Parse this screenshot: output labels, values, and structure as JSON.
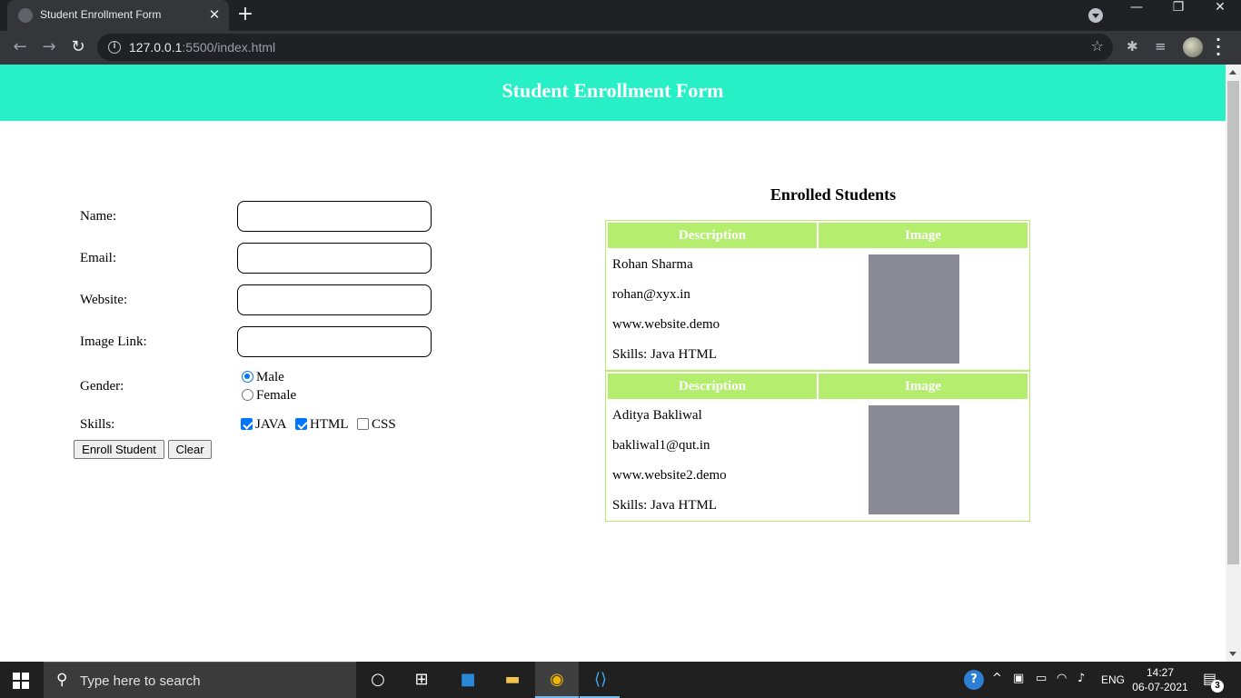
{
  "browser": {
    "tab_title": "Student Enrollment Form",
    "tab_close": "✕",
    "new_tab": "+",
    "url_host": "127.0.0.1",
    "url_rest": ":5500/index.html",
    "window_buttons": {
      "minimize": "—",
      "restore": "❐",
      "close": "✕"
    }
  },
  "page": {
    "banner_title": "Student Enrollment Form",
    "banner_color": "#27f0c7",
    "form": {
      "name_label": "Name:",
      "email_label": "Email:",
      "website_label": "Website:",
      "image_label": "Image Link:",
      "gender_label": "Gender:",
      "gender_options": [
        "Male",
        "Female"
      ],
      "gender_selected": "Male",
      "skills_label": "Skills:",
      "skills": [
        {
          "label": "JAVA",
          "checked": true
        },
        {
          "label": "HTML",
          "checked": true
        },
        {
          "label": "CSS",
          "checked": false
        }
      ],
      "enroll_button": "Enroll Student",
      "clear_button": "Clear"
    },
    "enrolled": {
      "title": "Enrolled Students",
      "header_color": "#b5ee6e",
      "col_description": "Description",
      "col_image": "Image",
      "students": [
        {
          "name": "Rohan Sharma",
          "email": "rohan@xyx.in",
          "website": "www.website.demo",
          "skills": "Skills: Java HTML"
        },
        {
          "name": "Aditya Bakliwal",
          "email": "bakliwal1@qut.in",
          "website": "www.website2.demo",
          "skills": "Skills: Java HTML"
        }
      ]
    }
  },
  "taskbar": {
    "search_placeholder": "Type here to search",
    "language": "ENG",
    "time": "14:27",
    "date": "06-07-2021",
    "notification_count": "3"
  }
}
